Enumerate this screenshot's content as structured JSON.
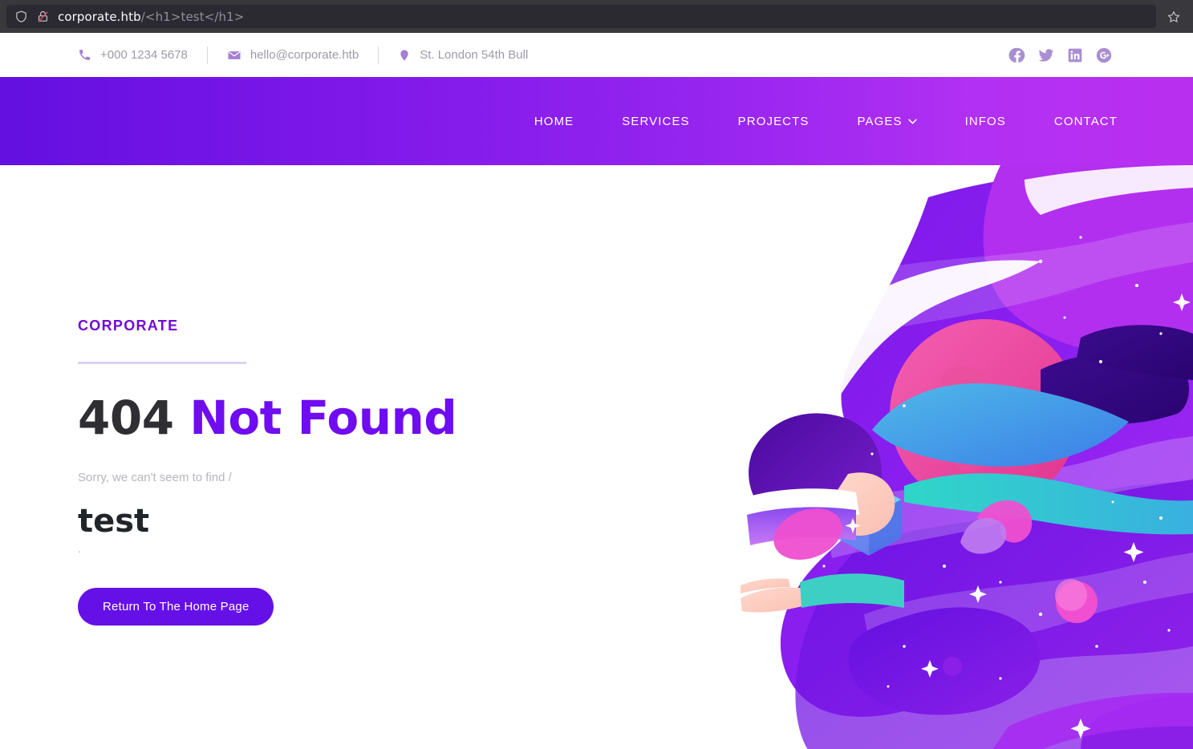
{
  "browser": {
    "shield_icon": "shield-icon",
    "lock_icon": "lock-crossed-icon",
    "bookmark_icon": "star-icon",
    "url_host": "corporate.htb",
    "url_path": "/<h1>test</h1>",
    "url_full": "corporate.htb/<h1>test</h1>"
  },
  "topbar": {
    "contacts": [
      {
        "icon": "phone-icon",
        "label": "+000 1234 5678"
      },
      {
        "icon": "envelope-icon",
        "label": "hello@corporate.htb"
      },
      {
        "icon": "location-pin-icon",
        "label": "St. London 54th Bull"
      }
    ],
    "socials": [
      {
        "icon": "facebook-icon",
        "label": "Facebook"
      },
      {
        "icon": "twitter-icon",
        "label": "Twitter"
      },
      {
        "icon": "linkedin-icon",
        "label": "LinkedIn"
      },
      {
        "icon": "google-plus-icon",
        "label": "Google Plus"
      }
    ]
  },
  "nav": {
    "items": [
      {
        "label": "HOME",
        "has_dropdown": false
      },
      {
        "label": "SERVICES",
        "has_dropdown": false
      },
      {
        "label": "PROJECTS",
        "has_dropdown": false
      },
      {
        "label": "PAGES",
        "has_dropdown": true
      },
      {
        "label": "INFOS",
        "has_dropdown": false
      },
      {
        "label": "CONTACT",
        "has_dropdown": false
      }
    ]
  },
  "hero": {
    "eyebrow": "CORPORATE",
    "headline_code": "404",
    "headline_text": "Not Found",
    "subtext": "Sorry, we can't seem to find /",
    "injected_heading": "test",
    "injected_tail": ".",
    "button_label": "Return To The Home Page",
    "illustration_alt": "astronaut-vr-space-illustration"
  },
  "colors": {
    "brand_purple": "#6f0cf0",
    "eyebrow_purple": "#7309d6",
    "button_purple": "#6610e8",
    "nav_gradient_start": "#6310e0",
    "nav_gradient_end": "#b92ff0",
    "divider_lavender": "#ddd0f5",
    "muted_text": "#b6b6bd",
    "contact_text": "#9b9ba6",
    "social_icon": "#a98fd2",
    "chrome_bg": "#38383d",
    "urlbar_bg": "#2b2a33"
  }
}
